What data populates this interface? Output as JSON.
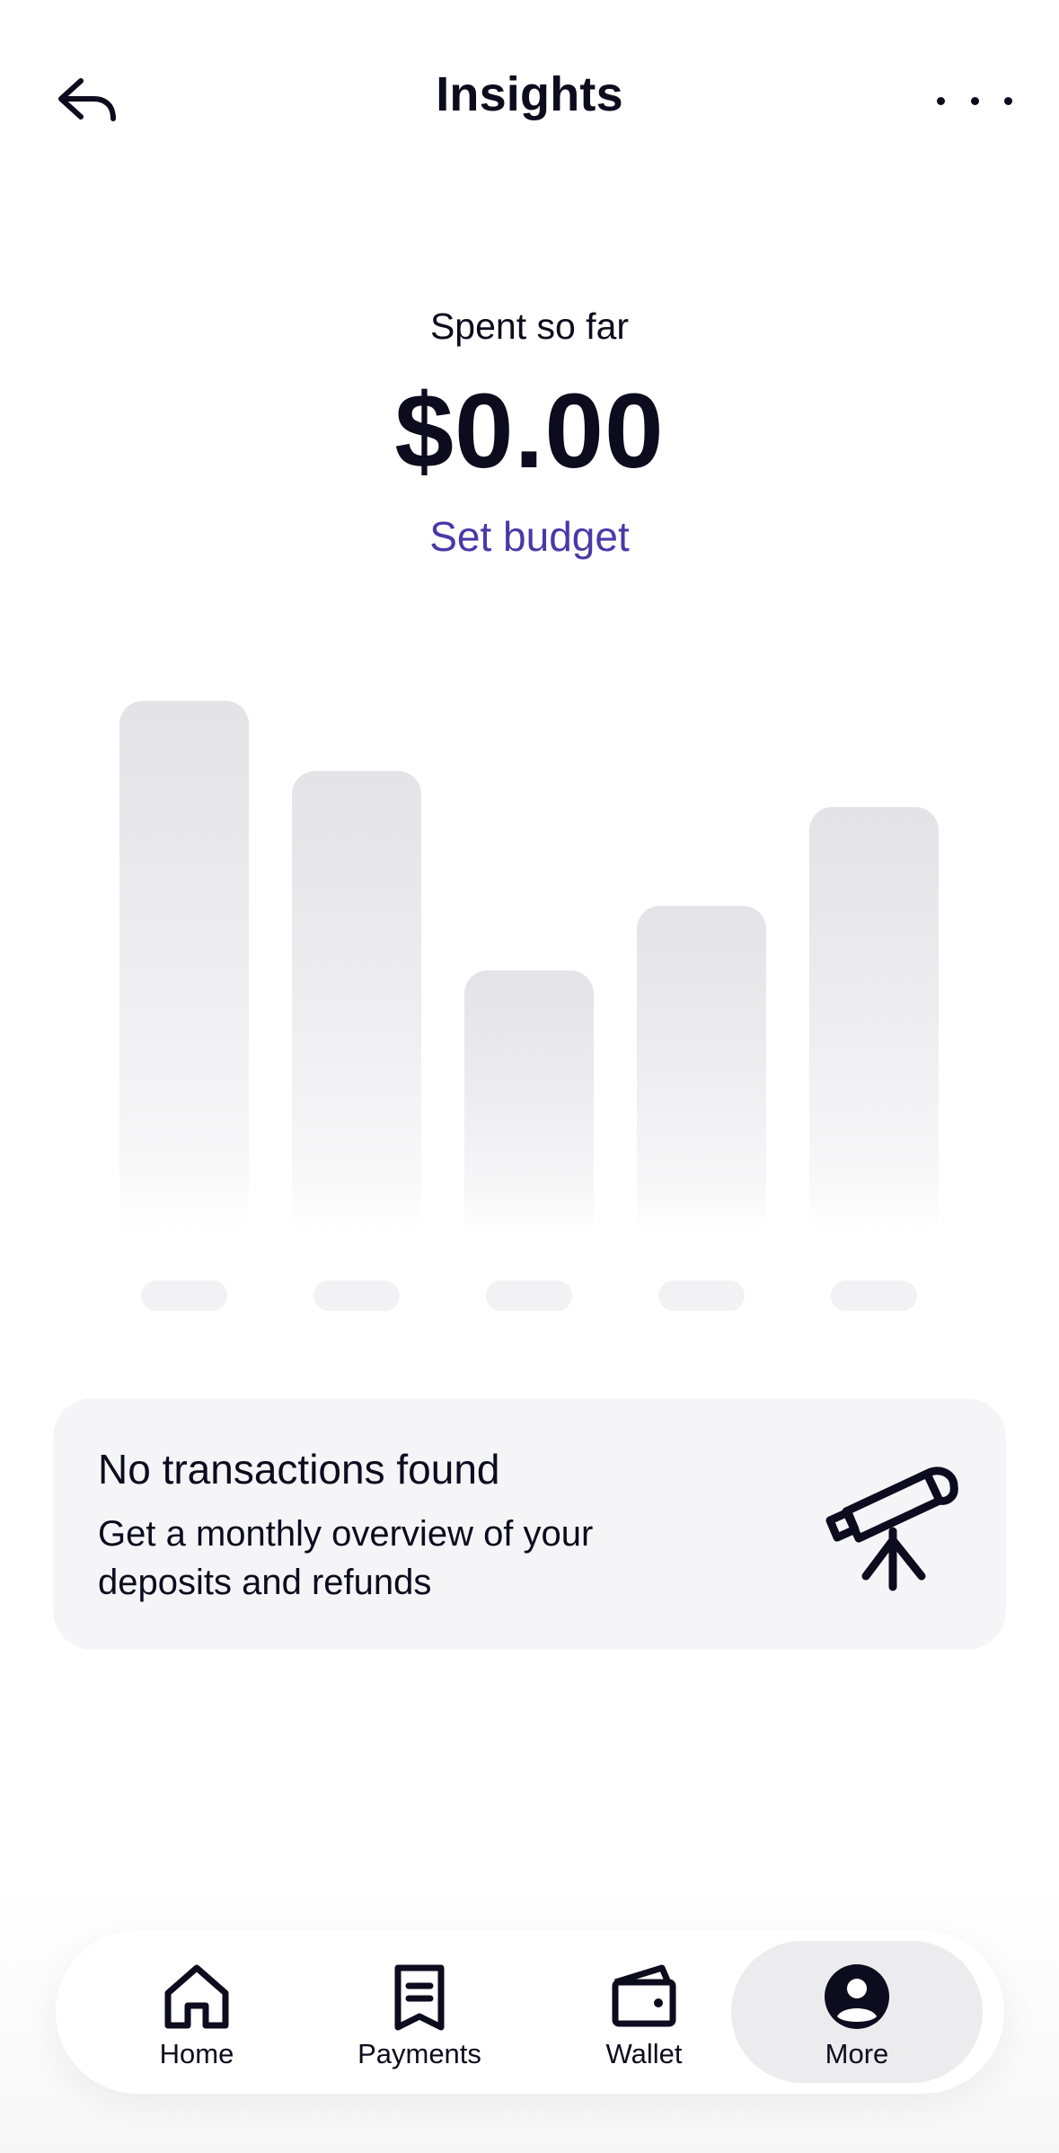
{
  "header": {
    "title": "Insights"
  },
  "summary": {
    "spent_label": "Spent so far",
    "amount": "$0.00",
    "set_budget_label": "Set budget"
  },
  "empty_state": {
    "title": "No transactions found",
    "description": "Get a monthly overview of your deposits and refunds"
  },
  "nav": {
    "items": [
      {
        "label": "Home",
        "icon": "home-icon",
        "active": false
      },
      {
        "label": "Payments",
        "icon": "receipt-icon",
        "active": false
      },
      {
        "label": "Wallet",
        "icon": "wallet-icon",
        "active": false
      },
      {
        "label": "More",
        "icon": "profile-icon",
        "active": true
      }
    ]
  },
  "colors": {
    "text": "#0d0b1e",
    "accent": "#4b38a8",
    "card_bg": "#f5f5f7",
    "placeholder_bar": "#e4e4e8"
  }
}
